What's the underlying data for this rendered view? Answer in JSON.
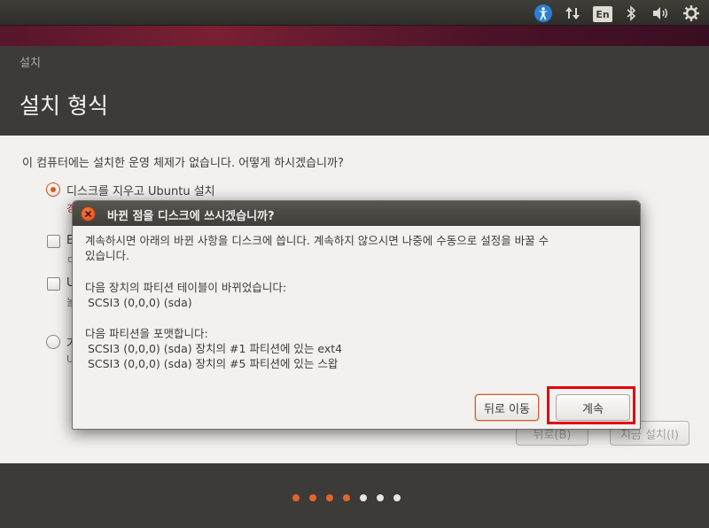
{
  "top_panel": {
    "keyboard_layout": "En",
    "icons": [
      "accessibility-icon",
      "network-icon",
      "keyboard-layout-indicator",
      "bluetooth-icon",
      "volume-icon",
      "gear-icon"
    ]
  },
  "installer": {
    "window_title": "설치",
    "step_title": "설치 형식",
    "question": "이 컴퓨터에는 설치한 운영 체제가 없습니다. 어떻게 하시겠습니까?",
    "options": [
      {
        "type": "radio",
        "selected": true,
        "label": "디스크를 지우고 Ubuntu 설치",
        "sub": "경"
      },
      {
        "type": "checkbox",
        "checked": false,
        "label": "E",
        "sub": "ㄷ"
      },
      {
        "type": "checkbox",
        "checked": false,
        "label": "U",
        "sub": "놀"
      },
      {
        "type": "radio",
        "selected": false,
        "label": "기",
        "sub": "U"
      }
    ],
    "back_button": "뒤로(B)",
    "install_button": "지금 설치(I)",
    "progress": {
      "completed_steps": 4,
      "total_steps": 7
    }
  },
  "dialog": {
    "title": "바뀐 점을 디스크에 쓰시겠습니까?",
    "intro_line1": "계속하시면 아래의 바뀐 사항을 디스크에 씁니다. 계속하지 않으시면 나중에 수동으로 설정을 바꿀 수",
    "intro_line2": "있습니다.",
    "partition_table_heading": "다음 장치의 파티션 테이블이 바뀌었습니다:",
    "partition_table_device": "SCSI3 (0,0,0) (sda)",
    "format_heading": "다음 파티션을 포맷합니다:",
    "format_items": [
      "SCSI3 (0,0,0) (sda) 장치의 #1 파티션에 있는 ext4",
      "SCSI3 (0,0,0) (sda) 장치의 #5 파티션에 있는 스왑"
    ],
    "go_back_button": "뒤로 이동",
    "continue_button": "계속"
  },
  "colors": {
    "accent": "#e0652a",
    "highlight": "#e30000"
  }
}
